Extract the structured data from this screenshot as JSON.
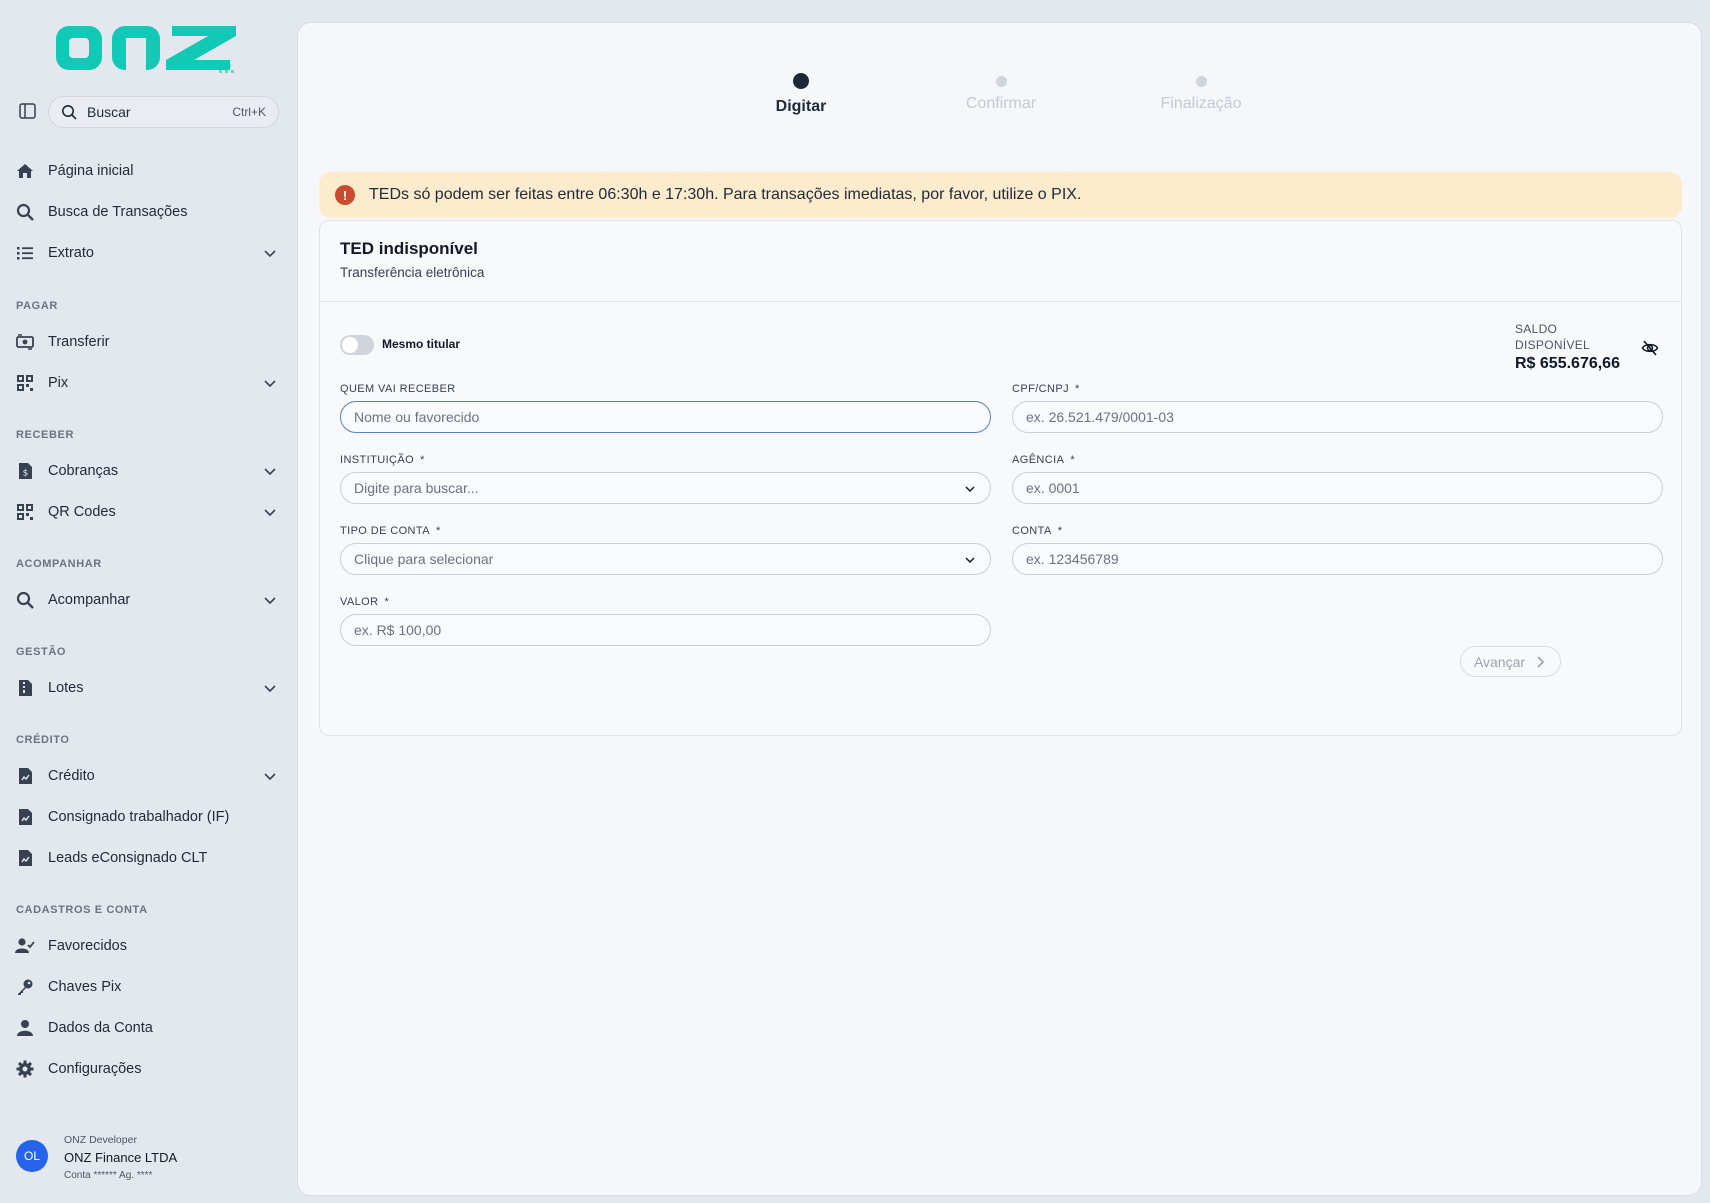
{
  "brand": {
    "logo_text": "onz",
    "accent": "#12c9b6"
  },
  "sidebar": {
    "search": {
      "label": "Buscar",
      "shortcut": "Ctrl+K"
    },
    "items_top": [
      {
        "label": "Página inicial",
        "icon": "home-icon"
      },
      {
        "label": "Busca de Transações",
        "icon": "search-icon"
      },
      {
        "label": "Extrato",
        "icon": "list-icon",
        "expandable": true
      }
    ],
    "sections": [
      {
        "title": "PAGAR",
        "items": [
          {
            "label": "Transferir",
            "icon": "money-transfer-icon"
          },
          {
            "label": "Pix",
            "icon": "qr-icon",
            "expandable": true
          }
        ]
      },
      {
        "title": "RECEBER",
        "items": [
          {
            "label": "Cobranças",
            "icon": "invoice-icon",
            "expandable": true
          },
          {
            "label": "QR Codes",
            "icon": "qr-icon",
            "expandable": true
          }
        ]
      },
      {
        "title": "ACOMPANHAR",
        "items": [
          {
            "label": "Acompanhar",
            "icon": "search-icon",
            "expandable": true
          }
        ]
      },
      {
        "title": "GESTÃO",
        "items": [
          {
            "label": "Lotes",
            "icon": "file-zip-icon",
            "expandable": true
          }
        ]
      },
      {
        "title": "CRÉDITO",
        "items": [
          {
            "label": "Crédito",
            "icon": "file-chart-icon",
            "expandable": true
          },
          {
            "label": "Consignado trabalhador (IF)",
            "icon": "file-chart-icon"
          },
          {
            "label": "Leads eConsignado CLT",
            "icon": "file-chart-icon"
          }
        ]
      },
      {
        "title": "CADASTROS E CONTA",
        "items": [
          {
            "label": "Favorecidos",
            "icon": "user-check-icon"
          },
          {
            "label": "Chaves Pix",
            "icon": "key-icon"
          },
          {
            "label": "Dados da Conta",
            "icon": "user-icon"
          },
          {
            "label": "Configurações",
            "icon": "gear-icon"
          }
        ]
      }
    ],
    "user": {
      "initials": "OL",
      "role": "ONZ Developer",
      "company": "ONZ Finance LTDA",
      "account": "Conta ****** Ag. ****"
    }
  },
  "stepper": {
    "steps": [
      {
        "label": "Digitar",
        "active": true
      },
      {
        "label": "Confirmar",
        "active": false
      },
      {
        "label": "Finalização",
        "active": false
      }
    ]
  },
  "alert": {
    "text": "TEDs só podem ser feitas entre 06:30h e 17:30h. Para transações imediatas, por favor, utilize o PIX."
  },
  "card": {
    "title": "TED indisponível",
    "subtitle": "Transferência eletrônica",
    "toggle_label": "Mesmo titular",
    "balance": {
      "label": "SALDO DISPONÍVEL",
      "value": "R$ 655.676,66"
    },
    "fields": {
      "recipient": {
        "label": "QUEM VAI RECEBER",
        "placeholder": "Nome ou favorecido"
      },
      "document": {
        "label": "CPF/CNPJ",
        "required": "*",
        "placeholder": "ex. 26.521.479/0001-03"
      },
      "institution": {
        "label": "INSTITUIÇÃO",
        "required": "*",
        "placeholder": "Digite para buscar..."
      },
      "agency": {
        "label": "AGÊNCIA",
        "required": "*",
        "placeholder": "ex. 0001"
      },
      "account_type": {
        "label": "TIPO DE CONTA",
        "required": "*",
        "placeholder": "Clique para selecionar"
      },
      "account": {
        "label": "CONTA",
        "required": "*",
        "placeholder": "ex. 123456789"
      },
      "amount": {
        "label": "VALOR",
        "required": "*",
        "placeholder": "ex. R$ 100,00"
      }
    },
    "next_label": "Avançar"
  }
}
